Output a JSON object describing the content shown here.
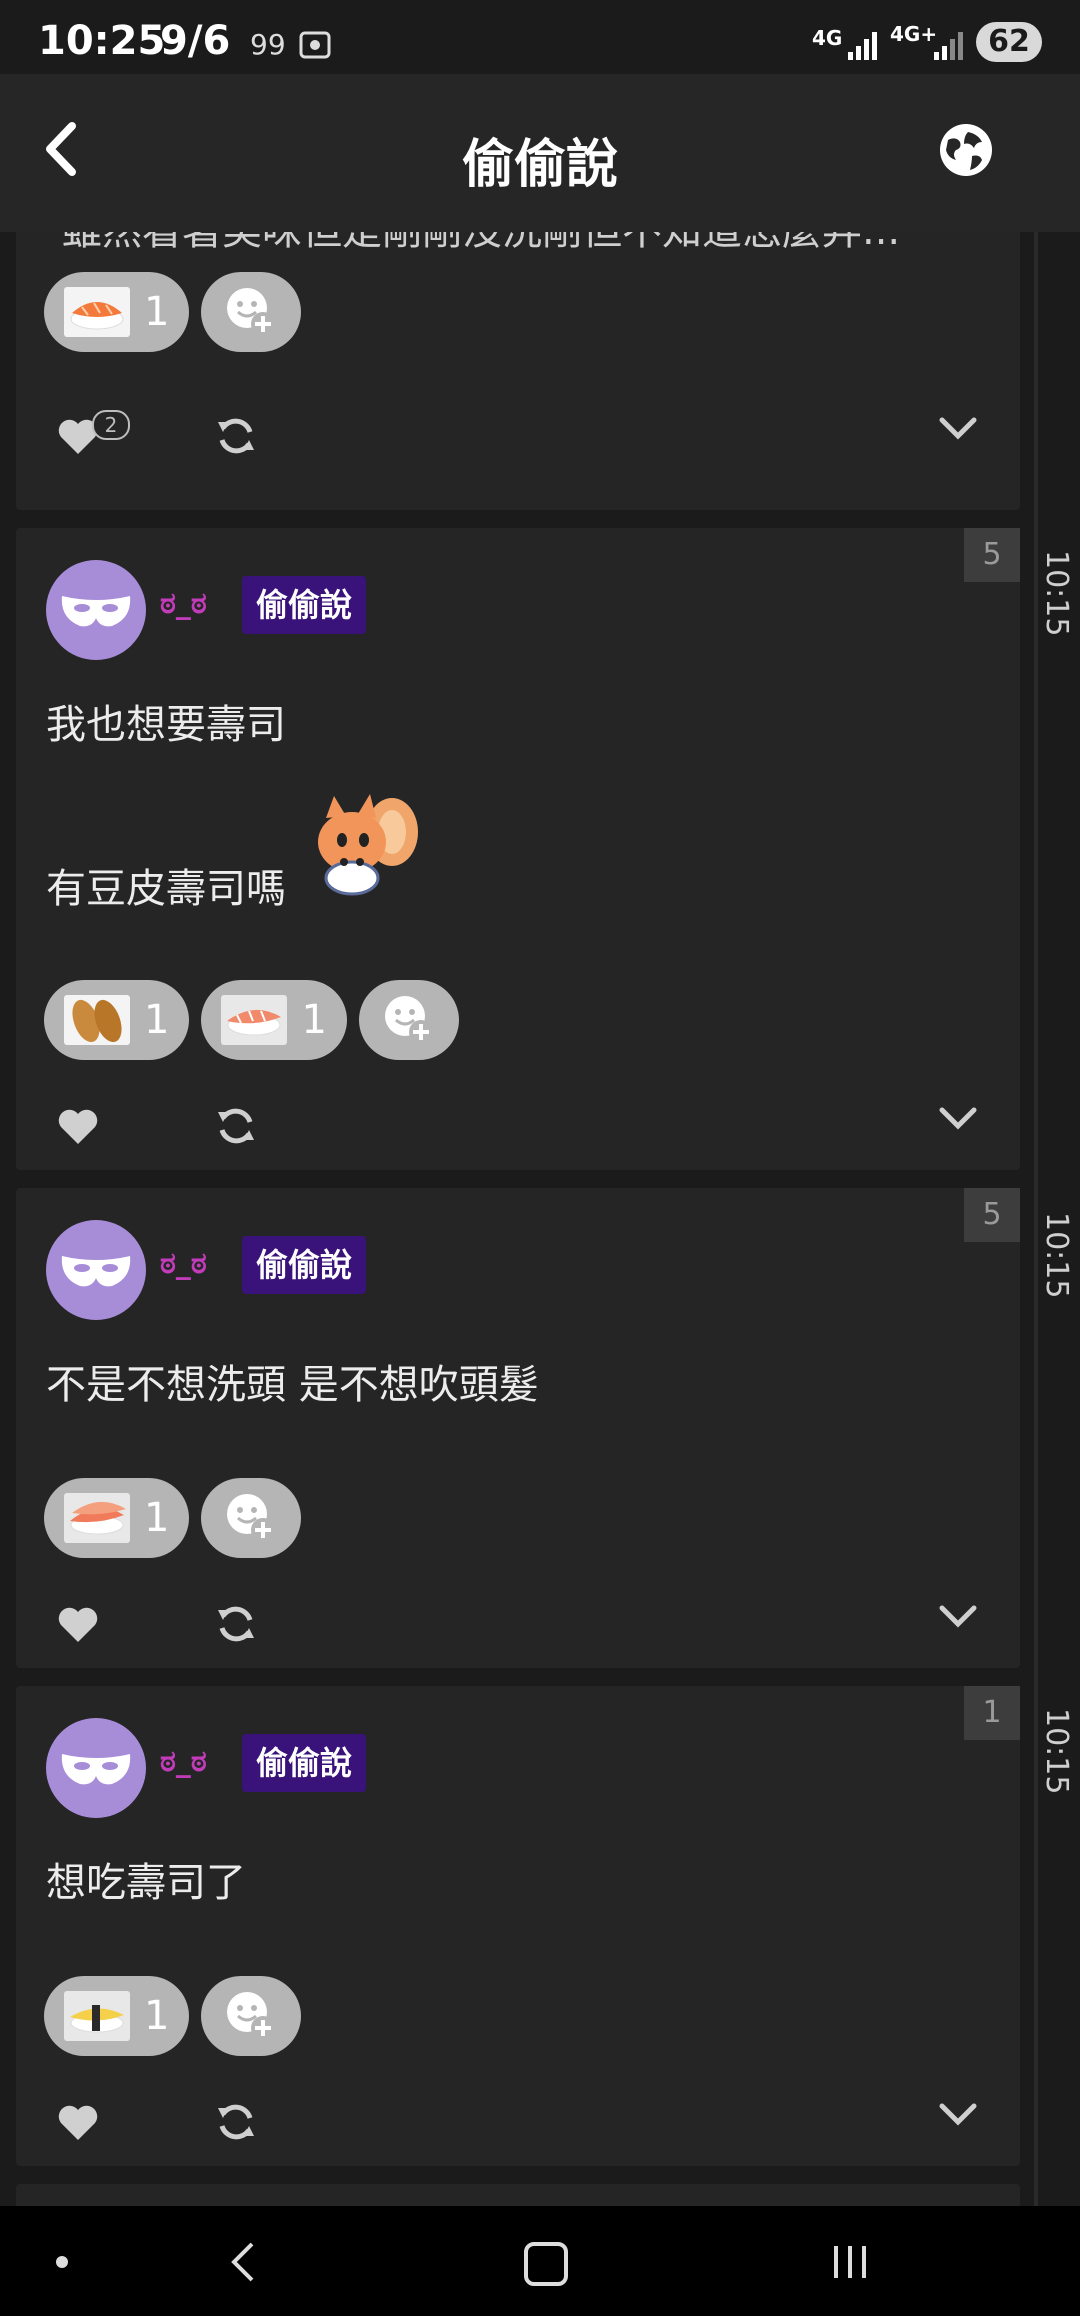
{
  "status_bar": {
    "time": "10:25",
    "date": "9/6",
    "notification_count": "99",
    "network1": "4G",
    "network2": "4G+",
    "battery": "62"
  },
  "app_bar": {
    "title": "偷偷說",
    "back_icon": "chevron-left-icon",
    "globe_icon": "globe-icon"
  },
  "feed": {
    "previous_post": {
      "partial_text": "雖然看著美味但是剛剛沒洗剛但不知道怎麼弄...",
      "reactions": [
        {
          "emoji": "salmon-sushi",
          "count": "1"
        }
      ],
      "likes": "2"
    },
    "posts": [
      {
        "reply_count": "5",
        "username": "ಠ_ಠ",
        "board": "偷偷說",
        "lines": [
          "我也想要壽司",
          "有豆皮壽司嗎"
        ],
        "sticker": "squirrel-sticker",
        "reactions": [
          {
            "emoji": "inari-sushi",
            "count": "1"
          },
          {
            "emoji": "shrimp-sushi",
            "count": "1"
          }
        ],
        "time": "10:15"
      },
      {
        "reply_count": "5",
        "username": "ಠ_ಠ",
        "board": "偷偷說",
        "lines": [
          "不是不想洗頭 是不想吹頭髮"
        ],
        "reactions": [
          {
            "emoji": "shrimp-sushi",
            "count": "1"
          }
        ],
        "time": "10:15"
      },
      {
        "reply_count": "1",
        "username": "ಠ_ಠ",
        "board": "偷偷說",
        "lines": [
          "想吃壽司了"
        ],
        "reactions": [
          {
            "emoji": "tamago-sushi",
            "count": "1"
          }
        ],
        "time": "10:15"
      }
    ]
  },
  "colors": {
    "background": "#1b1b1b",
    "card": "#252525",
    "username": "#c23cba",
    "board_tag": "#3a137a",
    "avatar": "#a78cd8",
    "chip": "#b5b5b5"
  }
}
